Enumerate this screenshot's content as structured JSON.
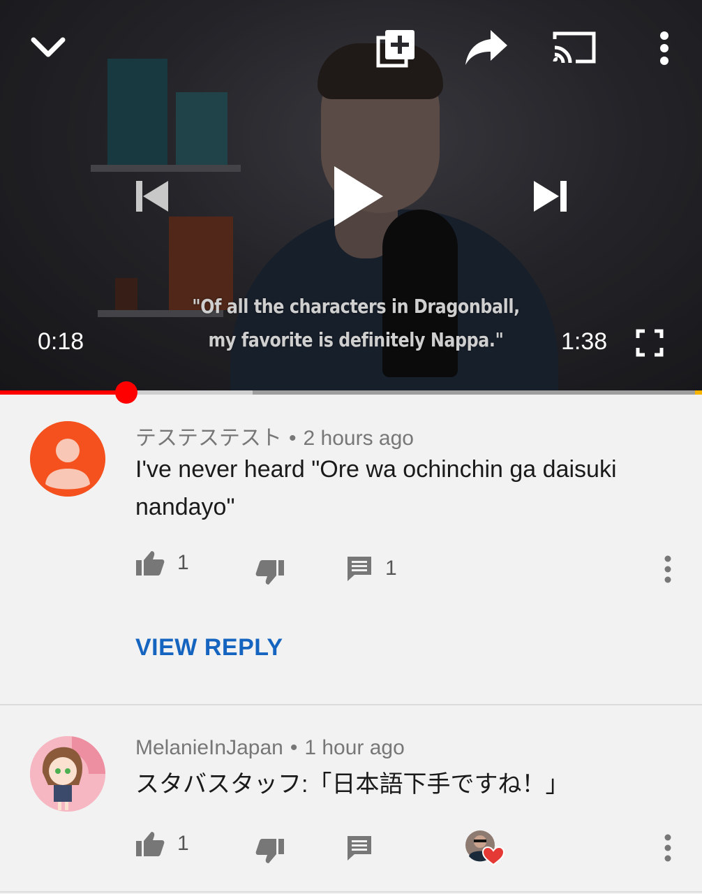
{
  "player": {
    "subtitle_line1": "\"Of all the characters in Dragonball,",
    "subtitle_line2": "my favorite is definitely Nappa.\"",
    "current_time": "0:18",
    "duration": "1:38",
    "progress_fraction": 0.18,
    "buffered_fraction": 0.36,
    "icons": [
      "chevron-down-icon",
      "add-to-queue-icon",
      "share-icon",
      "cast-icon",
      "more-vert-icon",
      "previous-icon",
      "play-icon",
      "next-icon",
      "fullscreen-icon"
    ],
    "colors": {
      "played": "#ff0000",
      "scrubber": "#ff0000"
    }
  },
  "comments": [
    {
      "author": "テステステスト",
      "time": "2 hours ago",
      "text": "I've never heard \"Ore wa ochinchin ga daisuki nandayo\"",
      "likes": "1",
      "replies": "1",
      "view_reply_label": "VIEW REPLY",
      "avatar_color": "#f4511e"
    },
    {
      "author": "MelanieInJapan",
      "time": "1 hour ago",
      "text": "スタバスタッフ:「日本語下手ですね！」",
      "likes": "1",
      "creator_heart": true
    }
  ],
  "colors": {
    "link_blue": "#1565c0",
    "background": "#f2f2f2"
  }
}
